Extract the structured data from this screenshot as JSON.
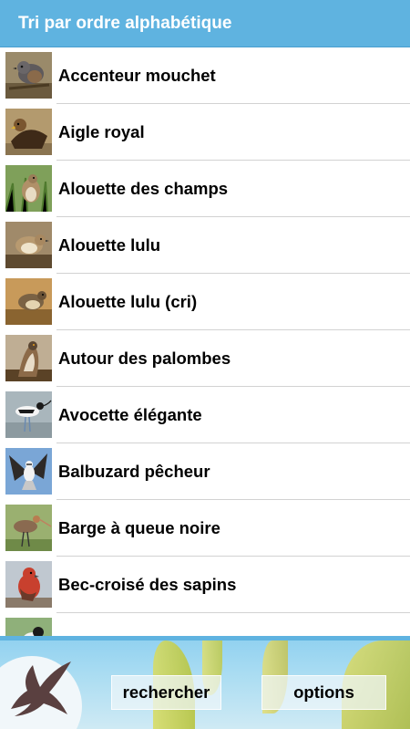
{
  "header": {
    "title": "Tri par ordre alphabétique"
  },
  "birds": [
    {
      "name": "Accenteur mouchet",
      "thumb": "accenteur-mouchet-photo"
    },
    {
      "name": "Aigle royal",
      "thumb": "aigle-royal-photo"
    },
    {
      "name": "Alouette des champs",
      "thumb": "alouette-des-champs-photo"
    },
    {
      "name": "Alouette lulu",
      "thumb": "alouette-lulu-photo"
    },
    {
      "name": "Alouette lulu (cri)",
      "thumb": "alouette-lulu-cri-photo"
    },
    {
      "name": "Autour des palombes",
      "thumb": "autour-des-palombes-photo"
    },
    {
      "name": "Avocette élégante",
      "thumb": "avocette-elegante-photo"
    },
    {
      "name": "Balbuzard pêcheur",
      "thumb": "balbuzard-pecheur-photo"
    },
    {
      "name": "Barge à queue noire",
      "thumb": "barge-a-queue-noire-photo"
    },
    {
      "name": "Bec-croisé des sapins",
      "thumb": "bec-croise-des-sapins-photo"
    },
    {
      "name": "",
      "thumb": "bergeronnette-photo-partial"
    }
  ],
  "footer": {
    "search_label": "rechercher",
    "options_label": "options",
    "logo_icon": "swallow-icon"
  },
  "colors": {
    "header_bg": "#5fb3e0",
    "header_text": "#ffffff",
    "divider": "#d2d2d2",
    "footer_bg": "#a9dcf2"
  }
}
